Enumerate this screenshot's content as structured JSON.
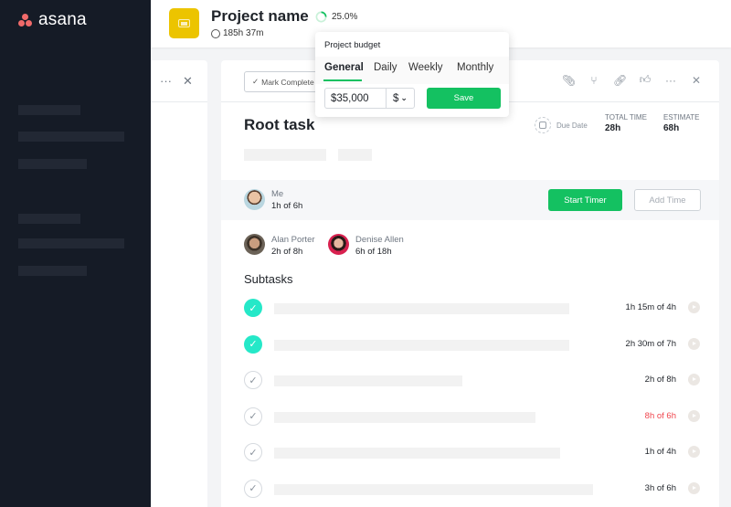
{
  "brand": {
    "name": "asana",
    "accent": "#f06a6a"
  },
  "sidebar": {
    "placeholder_rows": 6
  },
  "header": {
    "project_name": "Project name",
    "time_tracked": "185h 37m",
    "progress_label": "25.0%",
    "progress_fraction": 0.25,
    "project_icon_color": "#ecc400"
  },
  "budget_popover": {
    "title": "Project budget",
    "tabs": [
      "General",
      "Daily",
      "Weekly",
      "Monthly"
    ],
    "active_tab": "General",
    "amount_value": "$35,000",
    "currency": "$",
    "save_label": "Save"
  },
  "task": {
    "mark_complete_label": "Mark Complete",
    "title": "Root task",
    "due_date_label": "Due Date",
    "total_time_label": "TOTAL TIME",
    "total_time_value": "28h",
    "estimate_label": "ESTIMATE",
    "estimate_value": "68h",
    "me": {
      "name": "Me",
      "time": "1h of 6h"
    },
    "start_timer_label": "Start Timer",
    "add_time_label": "Add Time",
    "assignees": [
      {
        "name": "Alan Porter",
        "time": "2h of 8h"
      },
      {
        "name": "Denise Allen",
        "time": "6h of 18h"
      }
    ],
    "subtasks_title": "Subtasks",
    "subtasks": [
      {
        "done": true,
        "time": "1h 15m of 4h",
        "over": false
      },
      {
        "done": true,
        "time": "2h 30m of 7h",
        "over": false
      },
      {
        "done": false,
        "time": "2h of 8h",
        "over": false
      },
      {
        "done": false,
        "time": "8h of 6h",
        "over": true
      },
      {
        "done": false,
        "time": "1h of 4h",
        "over": false
      },
      {
        "done": false,
        "time": "3h of 6h",
        "over": false
      }
    ]
  },
  "colors": {
    "green": "#14c161",
    "teal_check": "#25e8c8",
    "over_red": "#f0454d",
    "sidebar_bg": "#151b26"
  }
}
